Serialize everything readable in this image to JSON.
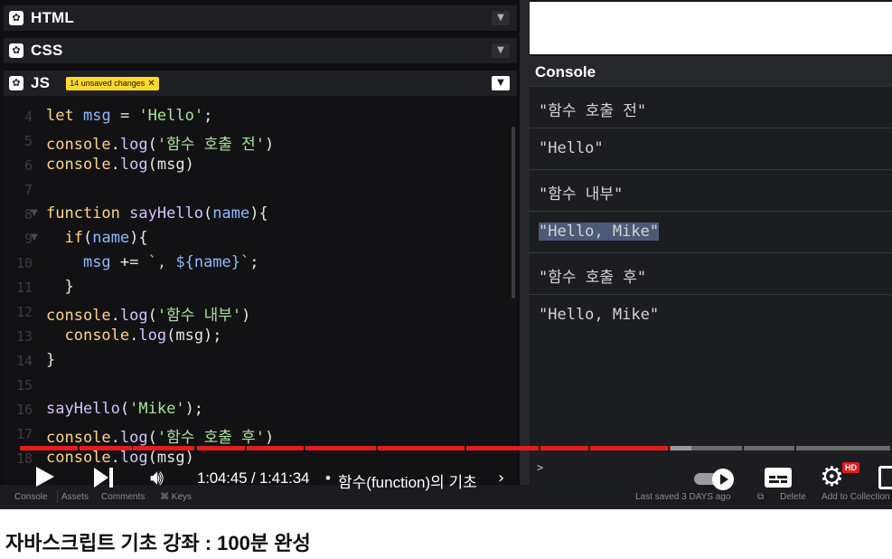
{
  "editor": {
    "panels": [
      {
        "name": "HTML"
      },
      {
        "name": "CSS"
      },
      {
        "name": "JS"
      }
    ],
    "js_badge": "14 unsaved changes",
    "lines": [
      {
        "n": "4",
        "code": "let msg = 'Hello';"
      },
      {
        "n": "5",
        "code": "console.log('함수 호출 전')"
      },
      {
        "n": "6",
        "code": "console.log(msg)"
      },
      {
        "n": "7",
        "code": ""
      },
      {
        "n": "8",
        "code": "function sayHello(name){"
      },
      {
        "n": "9",
        "code": "  if(name){"
      },
      {
        "n": "10",
        "code": "    msg += `, ${name}`;"
      },
      {
        "n": "11",
        "code": "  }"
      },
      {
        "n": "12",
        "code": "console.log('함수 내부')"
      },
      {
        "n": "13",
        "code": "  console.log(msg);"
      },
      {
        "n": "14",
        "code": "}"
      },
      {
        "n": "15",
        "code": ""
      },
      {
        "n": "16",
        "code": "sayHello('Mike');"
      },
      {
        "n": "17",
        "code": "console.log('함수 호출 후')"
      },
      {
        "n": "18",
        "code": "console.log(msg)"
      }
    ]
  },
  "console": {
    "title": "Console",
    "entries": [
      "\"함수 호출 전\"",
      "\"Hello\"",
      "\"함수 내부\"",
      "\"Hello, Mike\"",
      "\"함수 호출 후\"",
      "\"Hello, Mike\""
    ],
    "prompt": ">"
  },
  "bottom_bar": {
    "tabs": [
      "Console",
      "Assets",
      "Comments",
      "⌘ Keys"
    ],
    "last_saved": "Last saved 3 DAYS ago",
    "delete": "Delete",
    "add_to_collection": "Add to Collection"
  },
  "player": {
    "progress_fraction": 0.746,
    "buffered_fraction": 0.77,
    "time": "1:04:45 / 1:41:34",
    "separator": "•",
    "chapter": "함수(function)의 기초",
    "hd_badge": "HD",
    "icons": [
      "play-icon",
      "next-icon",
      "volume-icon",
      "autoplay-toggle",
      "captions-icon",
      "settings-icon",
      "fullscreen-icon"
    ]
  },
  "video_title": "자바스크립트 기초 강좌 : 100분 완성",
  "colors": {
    "progress": "#e21d1d",
    "badge": "#ffd92e",
    "string": "#a8e39a",
    "keyword": "#ffd580"
  }
}
